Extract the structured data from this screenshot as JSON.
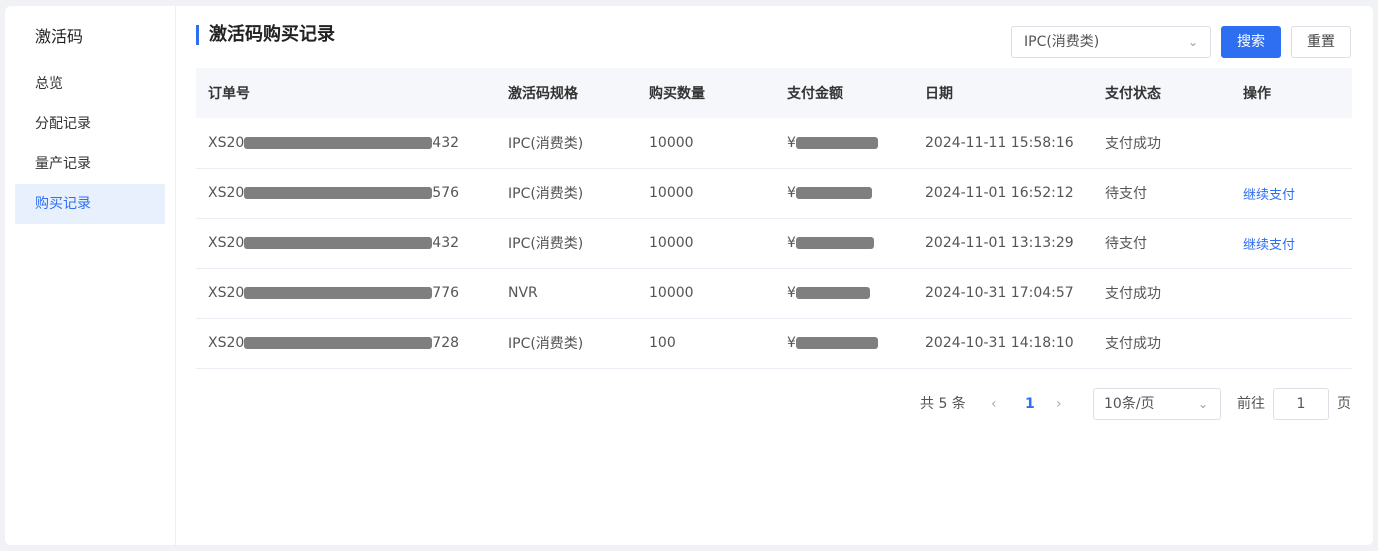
{
  "sidebar": {
    "title": "激活码",
    "items": [
      {
        "label": "总览"
      },
      {
        "label": "分配记录"
      },
      {
        "label": "量产记录"
      },
      {
        "label": "购买记录"
      }
    ]
  },
  "header": {
    "title": "激活码购买记录",
    "filter_value": "IPC(消费类)",
    "search_label": "搜索",
    "reset_label": "重置"
  },
  "table": {
    "columns": [
      "订单号",
      "激活码规格",
      "购买数量",
      "支付金额",
      "日期",
      "支付状态",
      "操作"
    ],
    "rows": [
      {
        "order_prefix": "XS20",
        "order_suffix": "432",
        "spec": "IPC(消费类)",
        "qty": "10000",
        "amount_prefix": "¥",
        "date": "2024-11-11 15:58:16",
        "status": "支付成功",
        "action": ""
      },
      {
        "order_prefix": "XS20",
        "order_suffix": "576",
        "spec": "IPC(消费类)",
        "qty": "10000",
        "amount_prefix": "¥",
        "date": "2024-11-01 16:52:12",
        "status": "待支付",
        "action": "继续支付"
      },
      {
        "order_prefix": "XS20",
        "order_suffix": "432",
        "spec": "IPC(消费类)",
        "qty": "10000",
        "amount_prefix": "¥",
        "date": "2024-11-01 13:13:29",
        "status": "待支付",
        "action": "继续支付"
      },
      {
        "order_prefix": "XS20",
        "order_suffix": "776",
        "spec": "NVR",
        "qty": "10000",
        "amount_prefix": "¥",
        "date": "2024-10-31 17:04:57",
        "status": "支付成功",
        "action": ""
      },
      {
        "order_prefix": "XS20",
        "order_suffix": "728",
        "spec": "IPC(消费类)",
        "qty": "100",
        "amount_prefix": "¥",
        "date": "2024-10-31 14:18:10",
        "status": "支付成功",
        "action": ""
      }
    ]
  },
  "pagination": {
    "total": "共 5 条",
    "current": "1",
    "page_size": "10条/页",
    "goto_label": "前往",
    "goto_value": "1",
    "page_suffix": "页"
  },
  "icons": {
    "chevron_down": "chevron-down-icon",
    "prev": "chevron-left-icon",
    "next": "chevron-right-icon"
  },
  "colors": {
    "accent": "#2e6ff2",
    "active_bg": "#e8f0fe"
  }
}
